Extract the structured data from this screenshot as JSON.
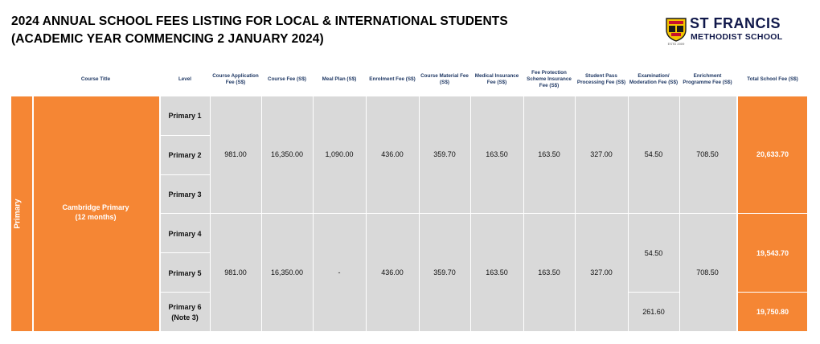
{
  "document": {
    "title_line1": "2024 ANNUAL SCHOOL FEES LISTING FOR LOCAL & INTERNATIONAL STUDENTS",
    "title_line2": "(ACADEMIC YEAR COMMENCING 2 JANUARY 2024)"
  },
  "logo": {
    "name": "ST FRANCIS",
    "subtitle": "METHODIST SCHOOL",
    "year": "ESTD 2009"
  },
  "table": {
    "headers": {
      "course_title": "Course Title",
      "level": "Level",
      "application": "Course Application Fee (S$)",
      "course_fee": "Course Fee (S$)",
      "meal_plan": "Meal Plan (S$)",
      "enrolment": "Enrolment Fee (S$)",
      "material": "Course Material Fee (S$)",
      "medical": "Medical Insurance Fee (S$)",
      "protection": "Fee Protection Scheme Insurance Fee (S$)",
      "student_pass": "Student Pass Processing Fee (S$)",
      "exam": "Examination/ Moderation Fee (S$)",
      "enrichment": "Enrichment Programme Fee (S$)",
      "total": "Total School Fee (S$)"
    },
    "category": "Primary",
    "course_line1": "Cambridge Primary",
    "course_line2": "(12 months)",
    "levels": [
      "Primary 1",
      "Primary 2",
      "Primary 3",
      "Primary 4",
      "Primary 5",
      "Primary 6",
      "(Note 3)"
    ],
    "group1": {
      "application": "981.00",
      "course_fee": "16,350.00",
      "meal_plan": "1,090.00",
      "enrolment": "436.00",
      "material": "359.70",
      "medical": "163.50",
      "protection": "163.50",
      "student_pass": "327.00",
      "exam": "54.50",
      "enrichment": "708.50",
      "total": "20,633.70"
    },
    "group2": {
      "application": "981.00",
      "course_fee": "16,350.00",
      "meal_plan": "-",
      "enrolment": "436.00",
      "material": "359.70",
      "medical": "163.50",
      "protection": "163.50",
      "student_pass": "327.00",
      "exam_p45": "54.50",
      "exam_p6": "261.60",
      "enrichment": "708.50",
      "total_p45": "19,543.70",
      "total_p6": "19,750.80"
    }
  }
}
